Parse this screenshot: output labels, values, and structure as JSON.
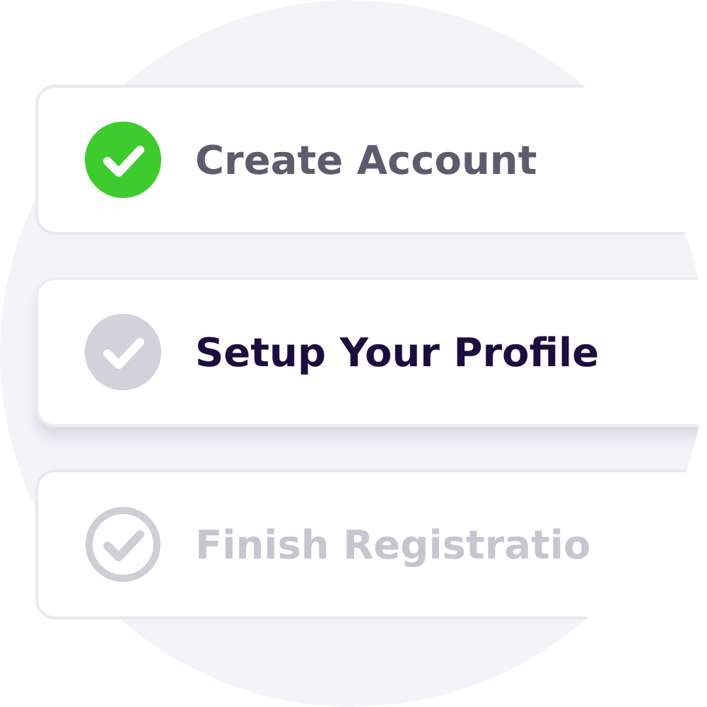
{
  "steps": [
    {
      "label": "Create Account",
      "completed": true,
      "selected": false
    },
    {
      "label": "Setup Your Profile",
      "completed": false,
      "selected": true
    },
    {
      "label": "Finish Registratio",
      "completed": false,
      "selected": false
    }
  ]
}
